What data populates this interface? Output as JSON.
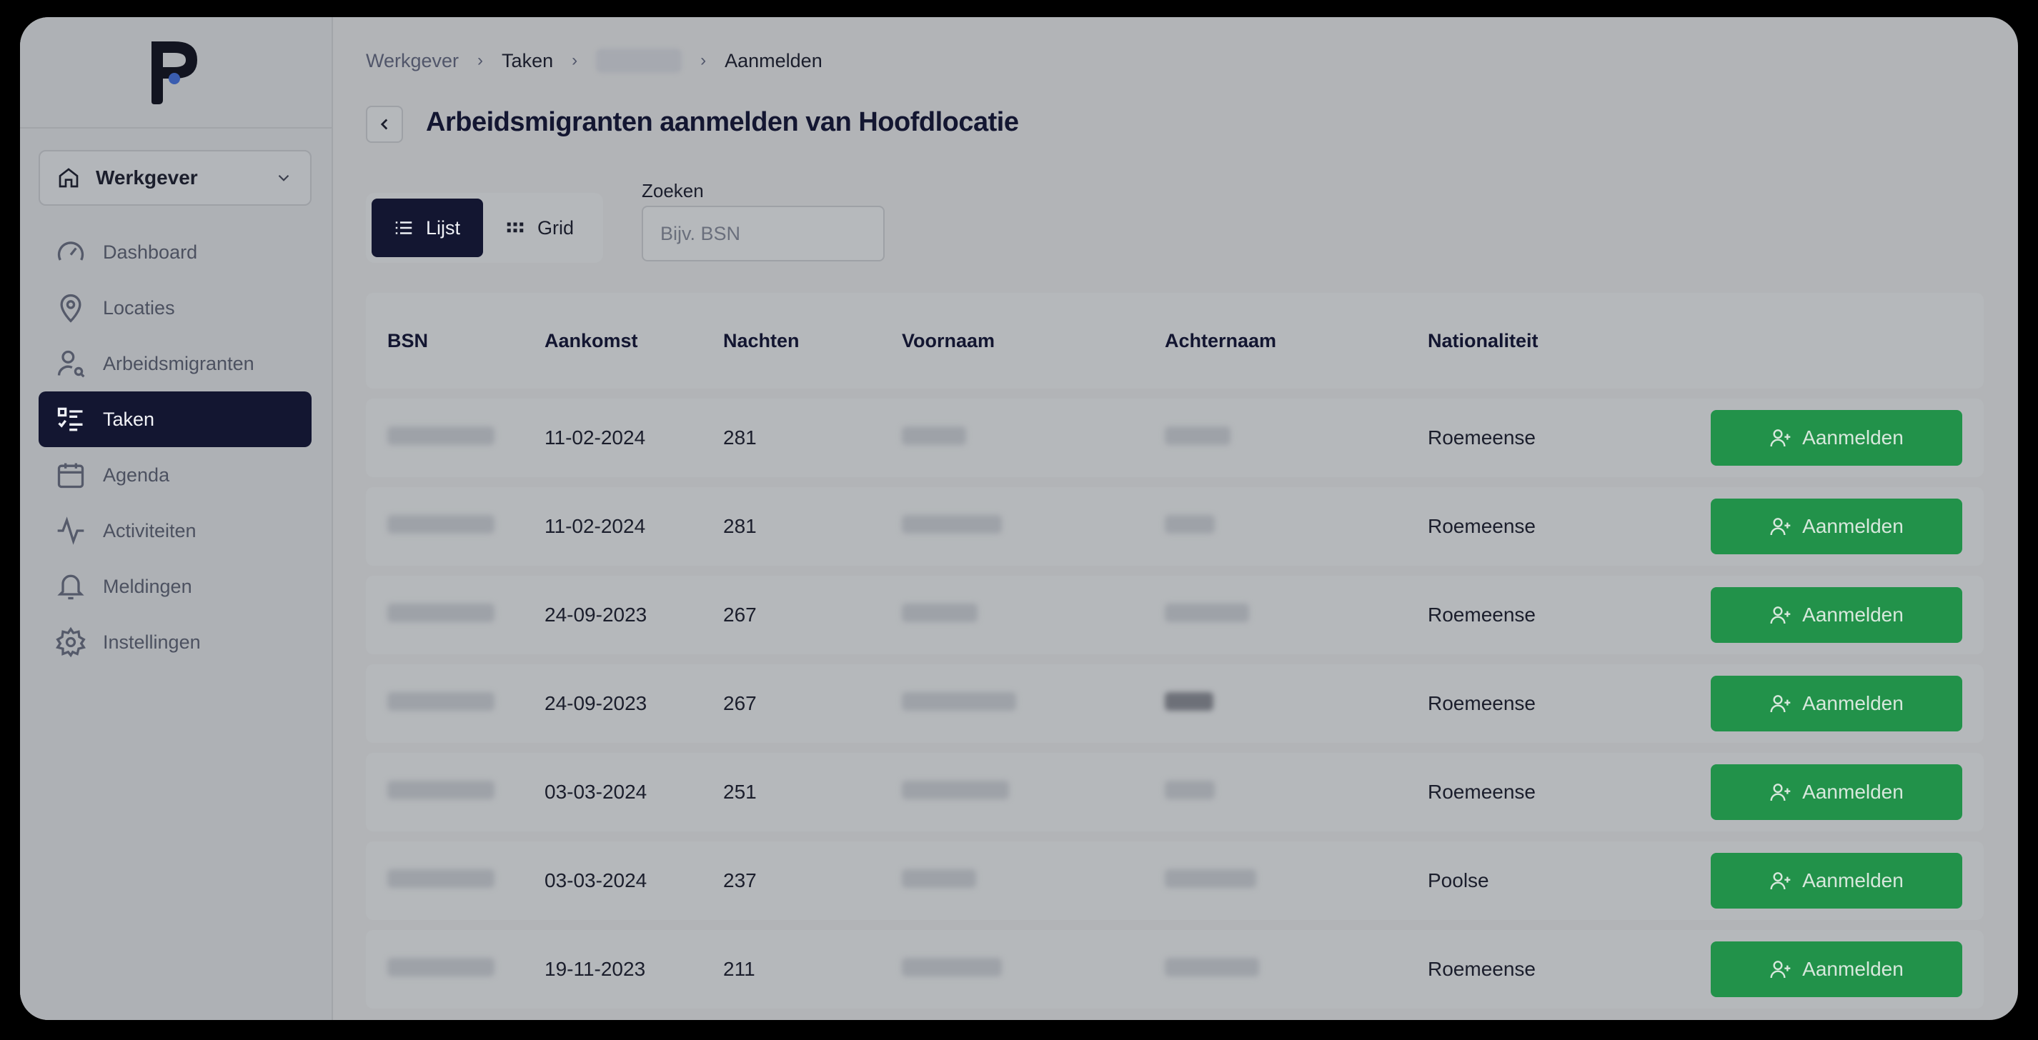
{
  "sidebar": {
    "workspace": "Werkgever",
    "items": [
      {
        "label": "Dashboard",
        "icon": "gauge-icon"
      },
      {
        "label": "Locaties",
        "icon": "map-pin-icon"
      },
      {
        "label": "Arbeidsmigranten",
        "icon": "user-search-icon"
      },
      {
        "label": "Taken",
        "icon": "task-list-icon",
        "active": true
      },
      {
        "label": "Agenda",
        "icon": "calendar-icon"
      },
      {
        "label": "Activiteiten",
        "icon": "activity-icon"
      },
      {
        "label": "Meldingen",
        "icon": "bell-icon"
      },
      {
        "label": "Instellingen",
        "icon": "gear-icon"
      }
    ]
  },
  "breadcrumb": {
    "items": [
      "Werkgever",
      "Taken"
    ],
    "current": "Aanmelden"
  },
  "page": {
    "title": "Arbeidsmigranten aanmelden van Hoofdlocatie"
  },
  "view": {
    "list": "Lijst",
    "grid": "Grid"
  },
  "search": {
    "label": "Zoeken",
    "placeholder": "Bijv. BSN"
  },
  "table": {
    "headers": [
      "BSN",
      "Aankomst",
      "Nachten",
      "Voornaam",
      "Achternaam",
      "Nationaliteit"
    ],
    "action_label": "Aanmelden",
    "rows": [
      {
        "aankomst": "11-02-2024",
        "nachten": "281",
        "nationaliteit": "Roemeense"
      },
      {
        "aankomst": "11-02-2024",
        "nachten": "281",
        "nationaliteit": "Roemeense"
      },
      {
        "aankomst": "24-09-2023",
        "nachten": "267",
        "nationaliteit": "Roemeense"
      },
      {
        "aankomst": "24-09-2023",
        "nachten": "267",
        "nationaliteit": "Roemeense"
      },
      {
        "aankomst": "03-03-2024",
        "nachten": "251",
        "nationaliteit": "Roemeense"
      },
      {
        "aankomst": "03-03-2024",
        "nachten": "237",
        "nationaliteit": "Poolse"
      },
      {
        "aankomst": "19-11-2023",
        "nachten": "211",
        "nationaliteit": "Roemeense"
      }
    ]
  },
  "colors": {
    "accent": "#131631",
    "action": "#22924a",
    "overlay": "#b2b4b7"
  }
}
